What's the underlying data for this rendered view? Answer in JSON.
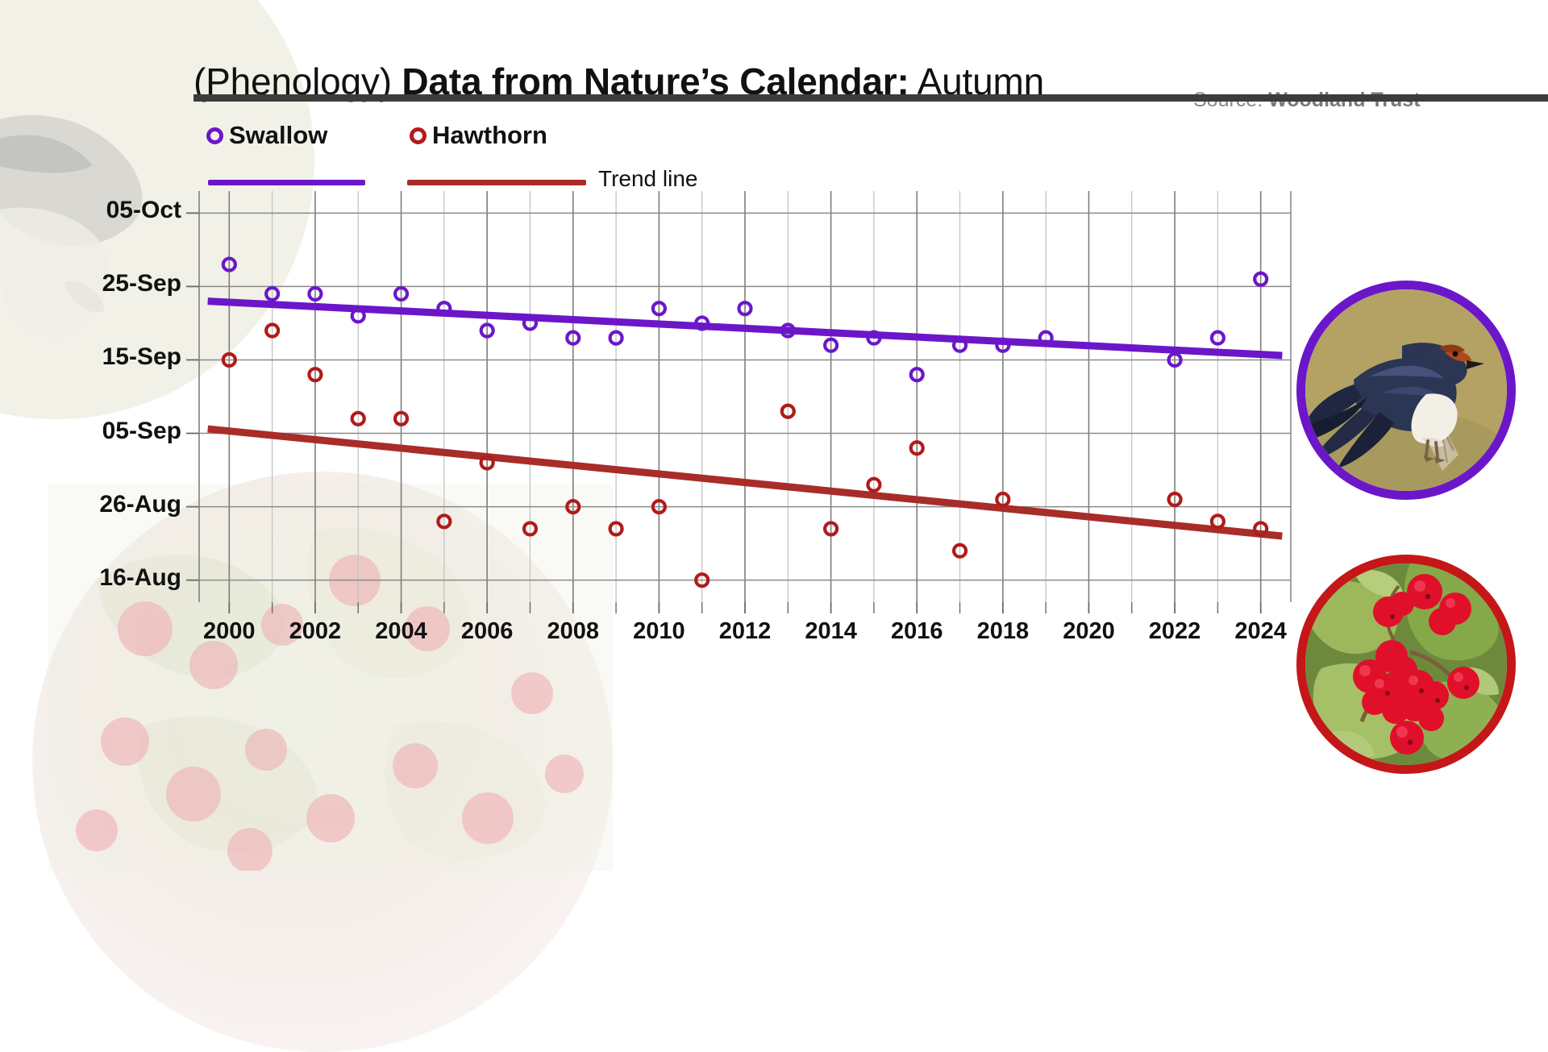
{
  "header": {
    "title_light": "(Phenology) ",
    "title_bold": "Data from Nature’s Calendar:",
    "title_tail": " Autumn",
    "source_label": "Source: ",
    "source_name": "Woodland Trust"
  },
  "legend": {
    "swallow_label": "Swallow",
    "hawthorn_label": "Hawthorn",
    "trend_label": "Trend line",
    "swallow_color": "#6B17C9",
    "hawthorn_color": "#B01B1B",
    "trend_hawthorn_color": "#A82C28"
  },
  "photos": {
    "swallow_alt": "Barn swallow perched on a wooden post",
    "hawthorn_alt": "Hawthorn branch with red berries",
    "swallow_ring": "#6B17C9",
    "hawthorn_ring": "#C51718"
  },
  "chart_data": {
    "type": "scatter",
    "title": "(Phenology) Data from Nature’s Calendar: Autumn",
    "xlabel": "",
    "ylabel": "",
    "grid": true,
    "legend_position": "top-left",
    "xlim": [
      1999.3,
      2024.7
    ],
    "x_ticks": [
      "2000",
      "2002",
      "2004",
      "2006",
      "2008",
      "2010",
      "2012",
      "2014",
      "2016",
      "2018",
      "2020",
      "2022",
      "2024"
    ],
    "x_tick_values": [
      2000,
      2002,
      2004,
      2006,
      2008,
      2010,
      2012,
      2014,
      2016,
      2018,
      2020,
      2022,
      2024
    ],
    "x_minor_every": 1,
    "y_ticks": [
      "16-Aug",
      "26-Aug",
      "05-Sep",
      "15-Sep",
      "25-Sep",
      "05-Oct"
    ],
    "y_tick_doy": [
      228,
      238,
      248,
      258,
      268,
      278
    ],
    "ylim_doy": [
      225,
      281
    ],
    "series": [
      {
        "name": "Swallow",
        "color": "#6B17C9",
        "marker": "open-circle",
        "x": [
          2000,
          2001,
          2002,
          2003,
          2004,
          2005,
          2006,
          2007,
          2008,
          2009,
          2010,
          2011,
          2012,
          2013,
          2014,
          2015,
          2016,
          2017,
          2018,
          2019,
          2022,
          2023,
          2024
        ],
        "y_labels": [
          "28-Sep",
          "24-Sep",
          "24-Sep",
          "21-Sep",
          "24-Sep",
          "22-Sep",
          "19-Sep",
          "20-Sep",
          "18-Sep",
          "18-Sep",
          "22-Sep",
          "20-Sep",
          "22-Sep",
          "19-Sep",
          "17-Sep",
          "18-Sep",
          "13-Sep",
          "17-Sep",
          "17-Sep",
          "18-Sep",
          "15-Sep",
          "18-Sep",
          "26-Sep"
        ],
        "y_doy": [
          271,
          267,
          267,
          264,
          267,
          265,
          262,
          263,
          261,
          261,
          265,
          263,
          265,
          262,
          260,
          261,
          256,
          260,
          260,
          261,
          258,
          261,
          269
        ]
      },
      {
        "name": "Hawthorn",
        "color": "#B01B1B",
        "marker": "open-circle",
        "x": [
          2000,
          2001,
          2002,
          2003,
          2004,
          2005,
          2006,
          2007,
          2008,
          2009,
          2010,
          2011,
          2013,
          2014,
          2015,
          2016,
          2017,
          2018,
          2022,
          2023,
          2024
        ],
        "y_labels": [
          "15-Sep",
          "19-Sep",
          "13-Sep",
          "07-Sep",
          "07-Sep",
          "24-Aug",
          "01-Sep",
          "23-Aug",
          "26-Aug",
          "23-Aug",
          "26-Aug",
          "16-Aug",
          "08-Sep",
          "23-Aug",
          "29-Aug",
          "03-Sep",
          "20-Aug",
          "27-Aug",
          "27-Aug",
          "24-Aug",
          "23-Aug"
        ],
        "y_doy": [
          258,
          262,
          256,
          250,
          250,
          236,
          244,
          235,
          238,
          235,
          238,
          228,
          251,
          235,
          241,
          246,
          232,
          239,
          239,
          236,
          235
        ]
      }
    ],
    "trend_lines": [
      {
        "name": "Swallow trend line",
        "color": "#6B17C9",
        "x": [
          1999.5,
          2024.5
        ],
        "y_doy": [
          266.0,
          258.6
        ]
      },
      {
        "name": "Hawthorn trend line",
        "color": "#A82C28",
        "x": [
          1999.5,
          2024.5
        ],
        "y_doy": [
          248.6,
          234.0
        ]
      }
    ]
  }
}
